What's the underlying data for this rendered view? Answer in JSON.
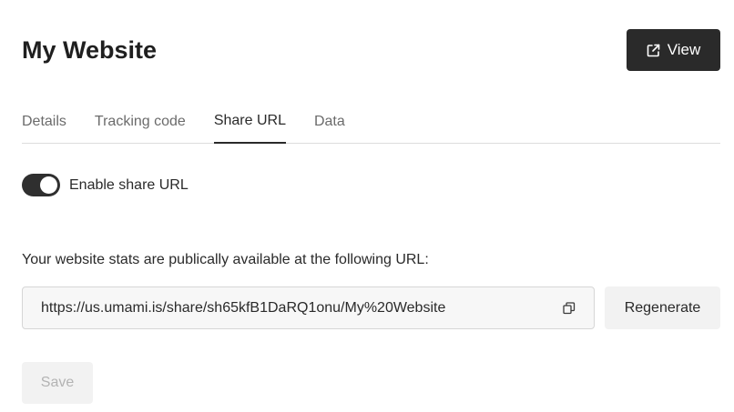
{
  "header": {
    "title": "My Website",
    "view_label": "View"
  },
  "tabs": [
    {
      "label": "Details",
      "active": false
    },
    {
      "label": "Tracking code",
      "active": false
    },
    {
      "label": "Share URL",
      "active": true
    },
    {
      "label": "Data",
      "active": false
    }
  ],
  "share": {
    "toggle_label": "Enable share URL",
    "toggle_on": true,
    "info_text": "Your website stats are publically available at the following URL:",
    "url": "https://us.umami.is/share/sh65kfB1DaRQ1onu/My%20Website",
    "regenerate_label": "Regenerate"
  },
  "actions": {
    "save_label": "Save",
    "save_disabled": true
  },
  "icons": {
    "view": "external-link-icon",
    "copy": "copy-icon"
  },
  "colors": {
    "primary": "#2a2a2a",
    "secondary_bg": "#f2f2f2",
    "disabled_text": "#b3b3b3"
  }
}
